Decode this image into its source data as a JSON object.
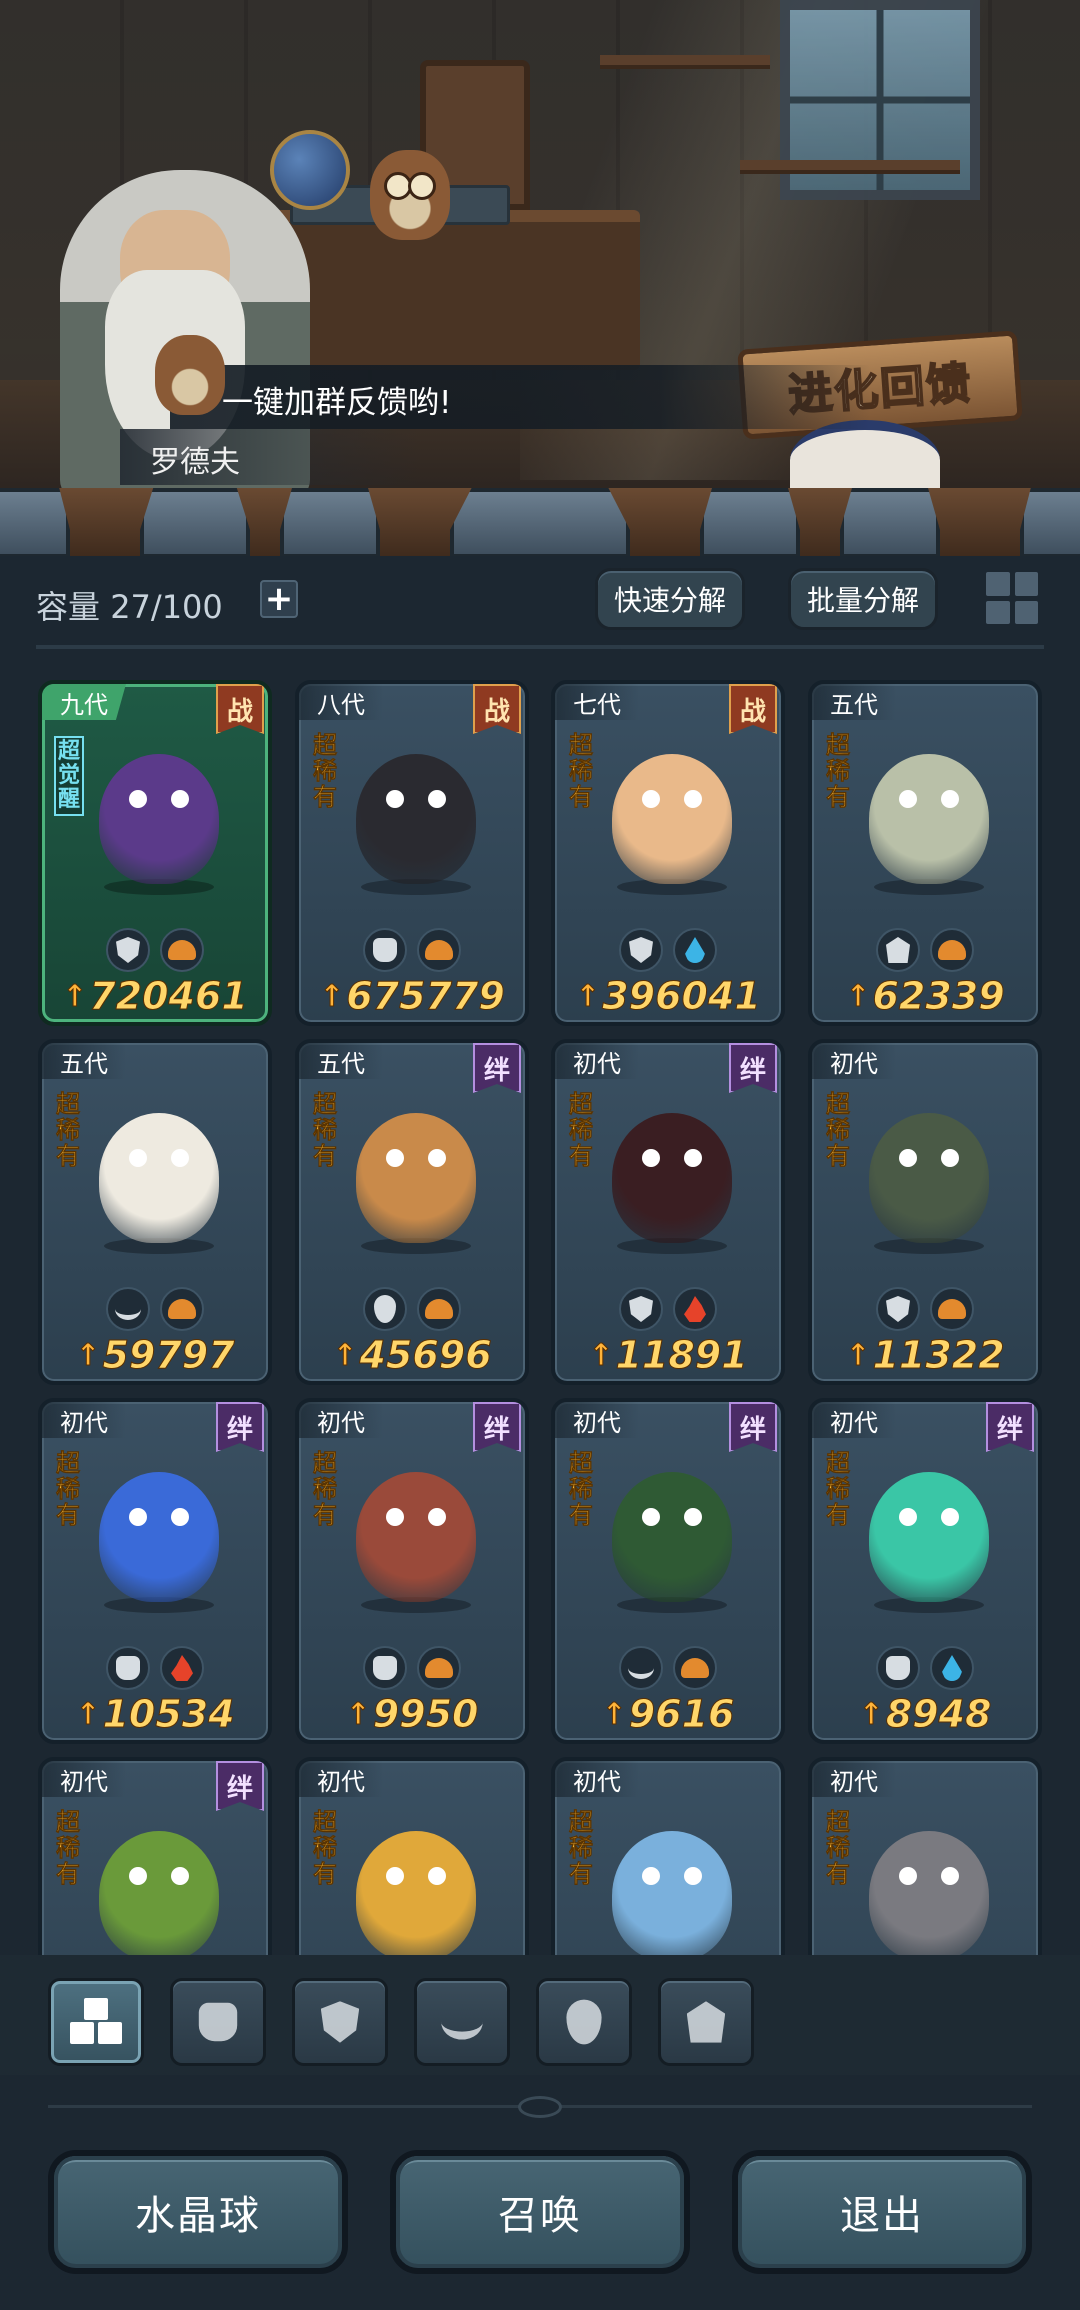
{
  "dialogue": {
    "text": "一键加群反馈哟!",
    "speaker": "罗德夫"
  },
  "banner": {
    "label": "进化回馈"
  },
  "toolbar": {
    "capacity_label": "容量",
    "capacity_value": "27/100",
    "plus_icon": "plus-icon",
    "quick_decompose": "快速分解",
    "batch_decompose": "批量分解",
    "view_toggle_icon": "grid-view-icon"
  },
  "colors": {
    "power_text": "#ffd66a",
    "rarity_text": "#f7b432",
    "battle_tag": "#8f3a21",
    "bond_tag": "#4b2c66",
    "awakened_border": "#4db37d"
  },
  "cards": [
    {
      "gen": "九代",
      "tag": "战",
      "rarity": "",
      "awaken": "超觉醒",
      "class_icon": "shield-icon",
      "element_icon": "earth-icon",
      "power": "720461",
      "tint": "#5b3a8a"
    },
    {
      "gen": "八代",
      "tag": "战",
      "rarity": "超稀有",
      "awaken": "",
      "class_icon": "fist-icon",
      "element_icon": "earth-icon",
      "power": "675779",
      "tint": "#2a2a30"
    },
    {
      "gen": "七代",
      "tag": "战",
      "rarity": "超稀有",
      "awaken": "",
      "class_icon": "shield-icon",
      "element_icon": "water-icon",
      "power": "396041",
      "tint": "#e9b98a"
    },
    {
      "gen": "五代",
      "tag": "",
      "rarity": "超稀有",
      "awaken": "",
      "class_icon": "tower-icon",
      "element_icon": "earth-icon",
      "power": "62339",
      "tint": "#b9c0a8"
    },
    {
      "gen": "五代",
      "tag": "",
      "rarity": "超稀有",
      "awaken": "",
      "class_icon": "leaf-icon",
      "element_icon": "earth-icon",
      "power": "59797",
      "tint": "#eeeae0"
    },
    {
      "gen": "五代",
      "tag": "绊",
      "rarity": "超稀有",
      "awaken": "",
      "class_icon": "alien-icon",
      "element_icon": "earth-icon",
      "power": "45696",
      "tint": "#c98a4a"
    },
    {
      "gen": "初代",
      "tag": "绊",
      "rarity": "超稀有",
      "awaken": "",
      "class_icon": "shield-icon",
      "element_icon": "fire-icon",
      "power": "11891",
      "tint": "#3a1e22"
    },
    {
      "gen": "初代",
      "tag": "",
      "rarity": "超稀有",
      "awaken": "",
      "class_icon": "shield-icon",
      "element_icon": "earth-icon",
      "power": "11322",
      "tint": "#4a5a46"
    },
    {
      "gen": "初代",
      "tag": "绊",
      "rarity": "超稀有",
      "awaken": "",
      "class_icon": "fist-icon",
      "element_icon": "fire-icon",
      "power": "10534",
      "tint": "#3a6ad8"
    },
    {
      "gen": "初代",
      "tag": "绊",
      "rarity": "超稀有",
      "awaken": "",
      "class_icon": "fist-icon",
      "element_icon": "earth-icon",
      "power": "9950",
      "tint": "#9a4a3a"
    },
    {
      "gen": "初代",
      "tag": "绊",
      "rarity": "超稀有",
      "awaken": "",
      "class_icon": "leaf-icon",
      "element_icon": "earth-icon",
      "power": "9616",
      "tint": "#2f5a34"
    },
    {
      "gen": "初代",
      "tag": "绊",
      "rarity": "超稀有",
      "awaken": "",
      "class_icon": "fist-icon",
      "element_icon": "water-icon",
      "power": "8948",
      "tint": "#3ac6a6"
    },
    {
      "gen": "初代",
      "tag": "绊",
      "rarity": "超稀有",
      "awaken": "",
      "class_icon": "",
      "element_icon": "",
      "power": "",
      "tint": "#6a9a3a"
    },
    {
      "gen": "初代",
      "tag": "",
      "rarity": "超稀有",
      "awaken": "",
      "class_icon": "",
      "element_icon": "",
      "power": "",
      "tint": "#e0a83a"
    },
    {
      "gen": "初代",
      "tag": "",
      "rarity": "超稀有",
      "awaken": "",
      "class_icon": "",
      "element_icon": "",
      "power": "",
      "tint": "#7ab0dc"
    },
    {
      "gen": "初代",
      "tag": "",
      "rarity": "超稀有",
      "awaken": "",
      "class_icon": "",
      "element_icon": "",
      "power": "",
      "tint": "#7a7a80"
    }
  ],
  "filter_tabs": [
    {
      "icon": "all-blocks-icon",
      "active": true
    },
    {
      "icon": "fist-icon",
      "active": false
    },
    {
      "icon": "shield-icon",
      "active": false
    },
    {
      "icon": "leaf-icon",
      "active": false
    },
    {
      "icon": "alien-icon",
      "active": false
    },
    {
      "icon": "tower-icon",
      "active": false
    }
  ],
  "bottom": {
    "crystal_ball": "水晶球",
    "summon": "召唤",
    "exit": "退出"
  }
}
